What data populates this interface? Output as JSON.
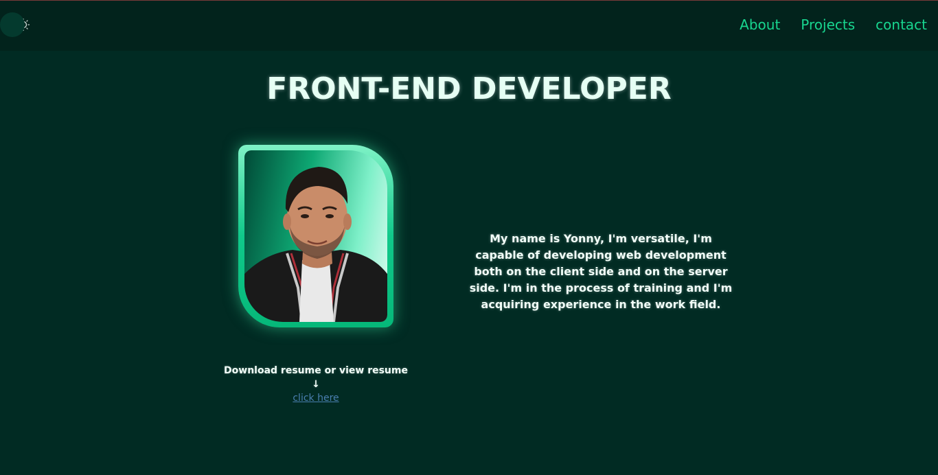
{
  "header": {
    "theme_toggle": {
      "icon": "sun-icon"
    },
    "nav": [
      {
        "label": "About"
      },
      {
        "label": "Projects"
      },
      {
        "label": "contact"
      }
    ]
  },
  "hero": {
    "title": "FRONT-END DEVELOPER",
    "bio": "My name is Yonny, I'm versatile, I'm capable of developing web development both on the client side and on the server side. I'm in the process of training and I'm acquiring experience in the work field.",
    "resume_label": "Download resume or view resume ↓",
    "resume_link": "click here"
  },
  "colors": {
    "background": "#012b23",
    "header": "#02231c",
    "accent": "#18d68f",
    "link": "#4a7fb0"
  }
}
